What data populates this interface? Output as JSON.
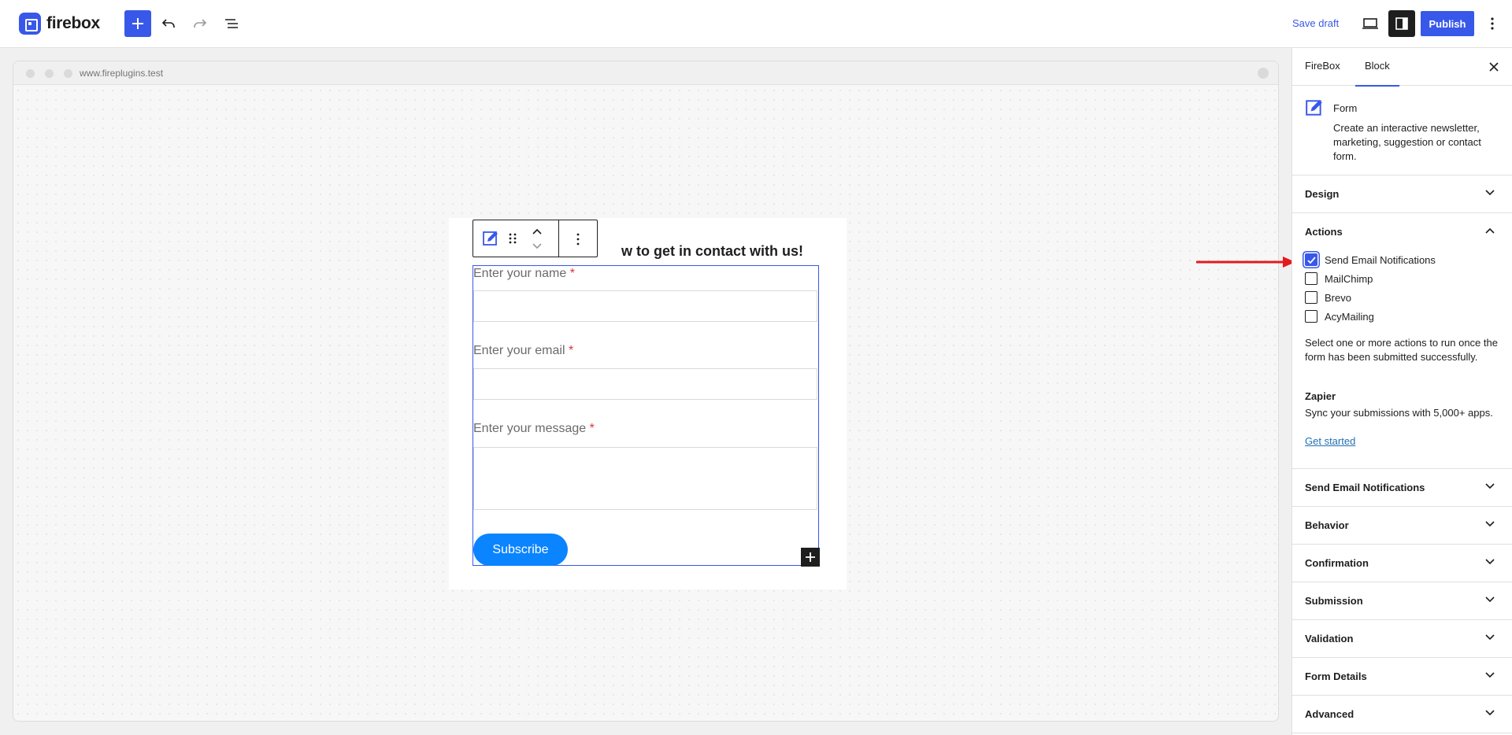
{
  "app": {
    "logo_text": "firebox"
  },
  "toolbar": {
    "save_draft": "Save draft",
    "publish": "Publish",
    "icons": [
      "plus-icon",
      "undo-icon",
      "redo-icon",
      "list-view-icon",
      "desktop-view-icon",
      "settings-panel-icon",
      "more-vertical-icon"
    ]
  },
  "browser": {
    "url": "www.fireplugins.test"
  },
  "form": {
    "title": "w to get in contact with us!",
    "fields": [
      {
        "label": "Enter your name",
        "required": "*"
      },
      {
        "label": "Enter your email",
        "required": "*"
      },
      {
        "label": "Enter your message",
        "required": "*"
      }
    ],
    "submit_label": "Subscribe"
  },
  "sidebar": {
    "tabs": [
      {
        "label": "FireBox"
      },
      {
        "label": "Block"
      }
    ],
    "active_tab": "Block",
    "block": {
      "name": "Form",
      "description": "Create an interactive newsletter, marketing, suggestion or contact form."
    },
    "panels_top": [
      {
        "title": "Design"
      }
    ],
    "actions": {
      "title": "Actions",
      "options": [
        {
          "label": "Send Email Notifications",
          "checked": true
        },
        {
          "label": "MailChimp",
          "checked": false
        },
        {
          "label": "Brevo",
          "checked": false
        },
        {
          "label": "AcyMailing",
          "checked": false
        }
      ],
      "help": "Select one or more actions to run once the form has been submitted successfully.",
      "zapier_title": "Zapier",
      "zapier_desc": "Sync your submissions with 5,000+ apps.",
      "zapier_link": "Get started"
    },
    "panels_bottom": [
      {
        "title": "Send Email Notifications"
      },
      {
        "title": "Behavior"
      },
      {
        "title": "Confirmation"
      },
      {
        "title": "Submission"
      },
      {
        "title": "Validation"
      },
      {
        "title": "Form Details"
      },
      {
        "title": "Advanced"
      }
    ]
  },
  "colors": {
    "accent": "#3858e9",
    "button": "#0a84ff",
    "required": "#d63638",
    "annotation_arrow": "#e5191d"
  }
}
